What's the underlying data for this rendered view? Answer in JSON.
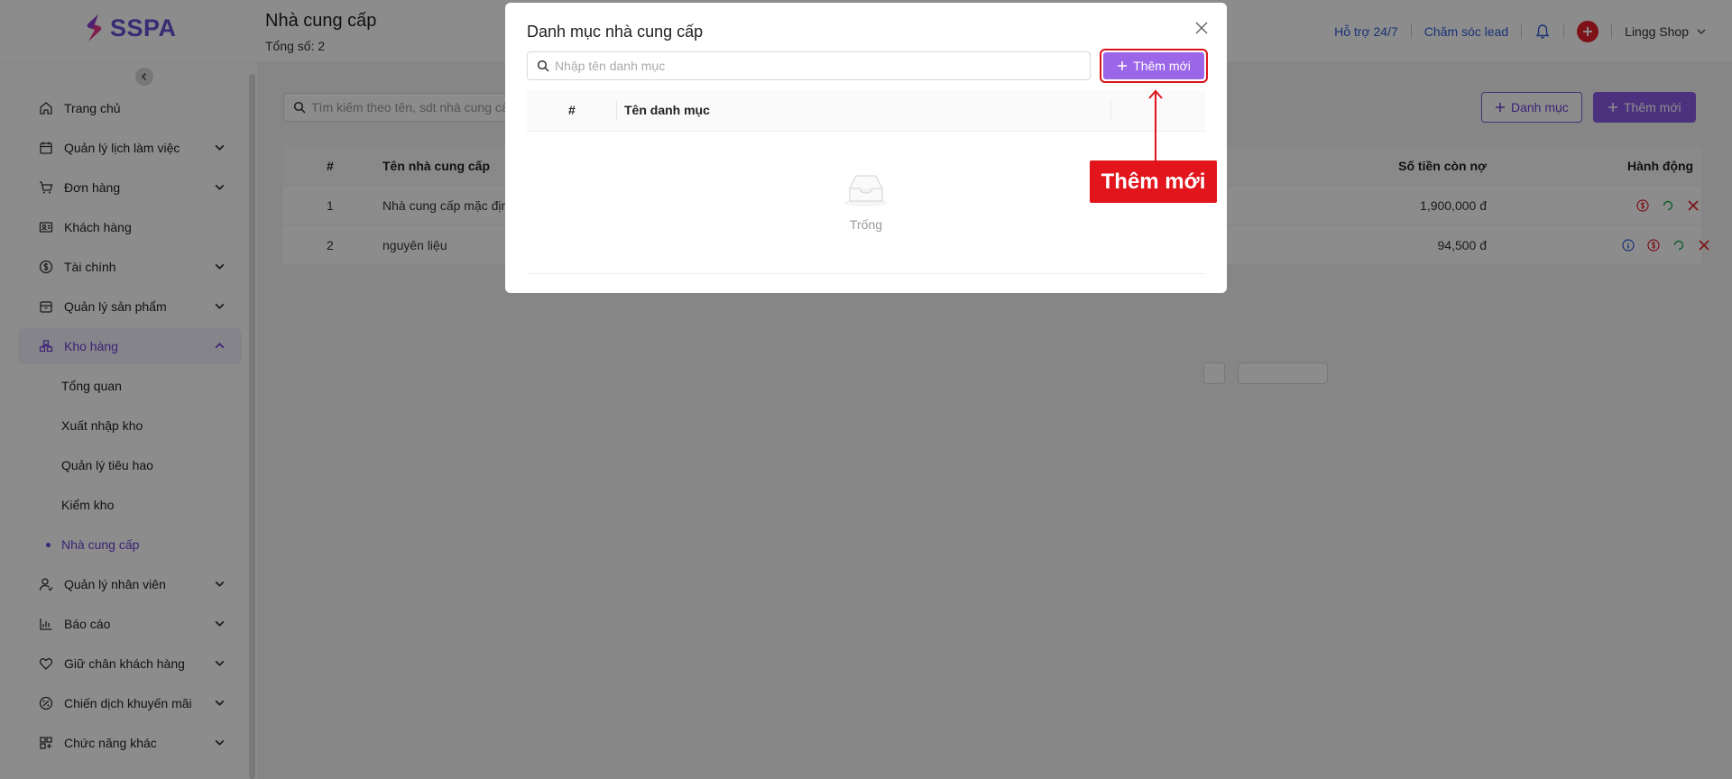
{
  "header": {
    "logo_text": "SSPA",
    "page_title": "Nhà cung cấp",
    "page_count": "Tổng số: 2",
    "support_link": "Hỗ trợ 24/7",
    "lead_link": "Chăm sóc lead",
    "shop_name": "Lingg Shop",
    "icons": [
      "bell-icon",
      "add-circle-icon",
      "chevron-down-icon"
    ]
  },
  "sidebar": {
    "items": [
      {
        "label": "Trang chủ",
        "icon": "home-icon"
      },
      {
        "label": "Quản lý lịch làm việc",
        "icon": "calendar-icon"
      },
      {
        "label": "Đơn hàng",
        "icon": "cart-icon"
      },
      {
        "label": "Khách hàng",
        "icon": "customer-icon"
      },
      {
        "label": "Tài chính",
        "icon": "dollar-icon"
      },
      {
        "label": "Quản lý sản phẩm",
        "icon": "box-icon"
      },
      {
        "label": "Kho hàng",
        "icon": "warehouse-icon"
      },
      {
        "label": "Quản lý nhân viên",
        "icon": "staff-icon"
      },
      {
        "label": "Báo cáo",
        "icon": "chart-icon"
      },
      {
        "label": "Giữ chân khách hàng",
        "icon": "heart-icon"
      },
      {
        "label": "Chiến dịch khuyến mãi",
        "icon": "promo-icon"
      },
      {
        "label": "Chức năng khác",
        "icon": "grid-icon"
      }
    ],
    "warehouse_sub": [
      {
        "label": "Tổng quan"
      },
      {
        "label": "Xuất nhập kho"
      },
      {
        "label": "Quản lý tiêu hao"
      },
      {
        "label": "Kiểm kho"
      },
      {
        "label": "Nhà cung cấp"
      }
    ],
    "active_item": "Kho hàng",
    "active_sub": "Nhà cung cấp"
  },
  "main": {
    "search_placeholder": "Tìm kiếm theo tên, sdt nhà cung cấp",
    "category_button": "Danh mục",
    "add_button": "Thêm mới",
    "table": {
      "headers": {
        "no": "#",
        "name": "Tên nhà cung cấp",
        "debt": "Số tiền còn nợ",
        "actions": "Hành động"
      },
      "rows": [
        {
          "no": "1",
          "name": "Nhà cung cấp mặc định",
          "debt": "1,900,000 đ"
        },
        {
          "no": "2",
          "name": "nguyên liệu",
          "debt": "94,500 đ"
        }
      ]
    }
  },
  "modal": {
    "title": "Danh mục nhà cung cấp",
    "search_placeholder": "Nhập tên danh mục",
    "add_button": "Thêm mới",
    "table_headers": {
      "no": "#",
      "name": "Tên danh mục"
    },
    "empty_text": "Trống"
  },
  "annotation": {
    "label": "Thêm mới",
    "color": "#e1151b"
  },
  "colors": {
    "brand": "#6a4fd6",
    "accent": "#8b5ce6",
    "link": "#2d5bd7",
    "danger": "#e5202a"
  }
}
